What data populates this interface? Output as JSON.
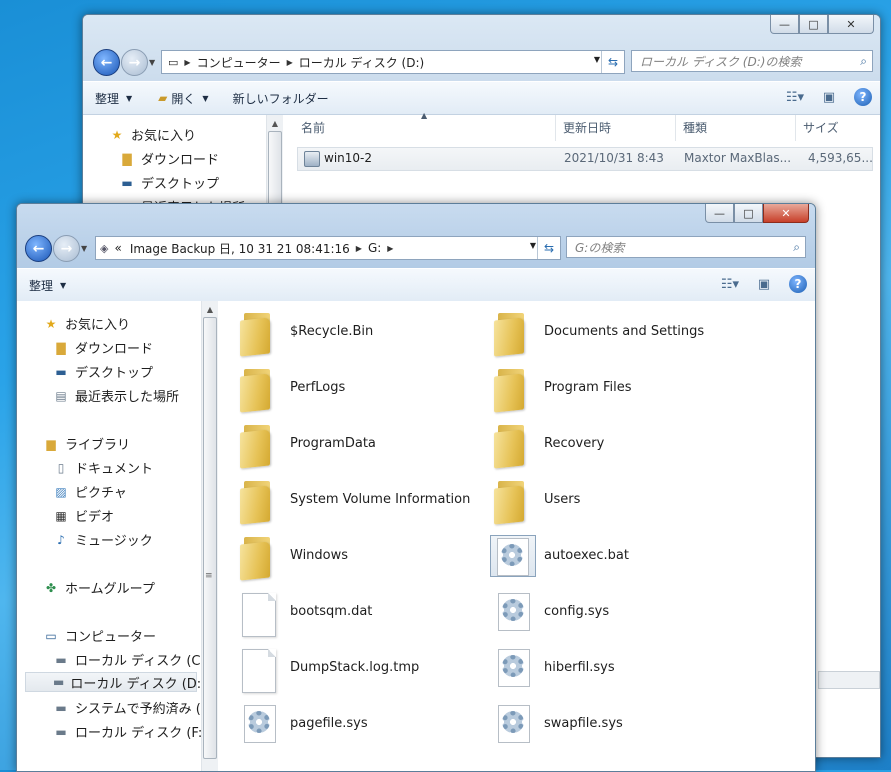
{
  "back_window": {
    "caption": {
      "minimize": "—",
      "maximize": "□",
      "close": "✕"
    },
    "address": {
      "crumbs": [
        "コンピューター",
        "ローカル ディスク (D:)"
      ]
    },
    "search_placeholder": "ローカル ディスク (D:)の検索",
    "toolbar": {
      "organize": "整理",
      "open": "開く",
      "new_folder": "新しいフォルダー"
    },
    "nav": [
      "お気に入り",
      "ダウンロード",
      "デスクトップ",
      "最近表示した場所"
    ],
    "columns": {
      "name": "名前",
      "date": "更新日時",
      "type": "種類",
      "size": "サイズ"
    },
    "rows": [
      {
        "name": "win10-2",
        "date": "2021/10/31 8:43",
        "type": "Maxtor MaxBlas...",
        "size": "4,593,65..."
      }
    ]
  },
  "front_window": {
    "caption": {
      "minimize": "—",
      "maximize": "□",
      "close": "✕"
    },
    "address": {
      "prefix": "«",
      "crumbs": [
        "Image Backup 日, 10 31 21 08:41:16",
        "G:"
      ]
    },
    "search_placeholder": "G:の検索",
    "toolbar": {
      "organize": "整理"
    },
    "nav": {
      "favorites": [
        "お気に入り",
        "ダウンロード",
        "デスクトップ",
        "最近表示した場所"
      ],
      "libraries": [
        "ライブラリ",
        "ドキュメント",
        "ピクチャ",
        "ビデオ",
        "ミュージック"
      ],
      "homegroup": "ホームグループ",
      "computer": [
        "コンピューター",
        "ローカル ディスク (C:)",
        "ローカル ディスク (D:)",
        "システムで予約済み (E",
        "ローカル ディスク (F:)"
      ]
    },
    "items_left": [
      "$Recycle.Bin",
      "PerfLogs",
      "ProgramData",
      "System Volume Information",
      "Windows",
      "bootsqm.dat",
      "DumpStack.log.tmp",
      "pagefile.sys"
    ],
    "items_right": [
      "Documents and Settings",
      "Program Files",
      "Recovery",
      "Users",
      "autoexec.bat",
      "config.sys",
      "hiberfil.sys",
      "swapfile.sys"
    ]
  }
}
